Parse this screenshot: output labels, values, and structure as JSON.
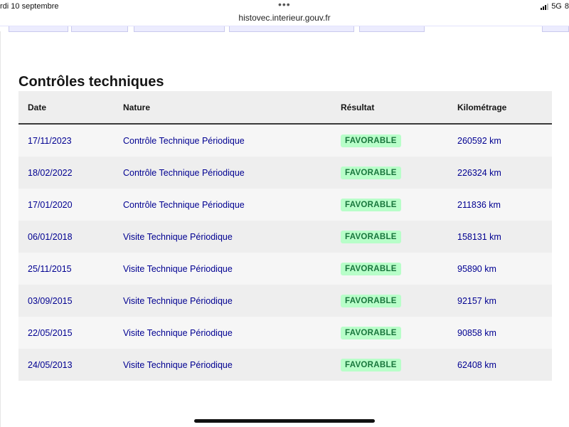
{
  "status_bar": {
    "date": "rdi 10 septembre",
    "network": "5G",
    "battery_partial": "8"
  },
  "browser": {
    "url": "histovec.interieur.gouv.fr"
  },
  "section": {
    "title": "Contrôles techniques"
  },
  "table": {
    "headers": {
      "date": "Date",
      "nature": "Nature",
      "resultat": "Résultat",
      "kilometrage": "Kilométrage"
    },
    "rows": [
      {
        "date": "17/11/2023",
        "nature": "Contrôle Technique Périodique",
        "resultat": "FAVORABLE",
        "km": "260592 km"
      },
      {
        "date": "18/02/2022",
        "nature": "Contrôle Technique Périodique",
        "resultat": "FAVORABLE",
        "km": "226324 km"
      },
      {
        "date": "17/01/2020",
        "nature": "Contrôle Technique Périodique",
        "resultat": "FAVORABLE",
        "km": "211836 km"
      },
      {
        "date": "06/01/2018",
        "nature": "Visite Technique Périodique",
        "resultat": "FAVORABLE",
        "km": "158131 km"
      },
      {
        "date": "25/11/2015",
        "nature": "Visite Technique Périodique",
        "resultat": "FAVORABLE",
        "km": "95890 km"
      },
      {
        "date": "03/09/2015",
        "nature": "Visite Technique Périodique",
        "resultat": "FAVORABLE",
        "km": "92157 km"
      },
      {
        "date": "22/05/2015",
        "nature": "Visite Technique Périodique",
        "resultat": "FAVORABLE",
        "km": "90858 km"
      },
      {
        "date": "24/05/2013",
        "nature": "Visite Technique Périodique",
        "resultat": "FAVORABLE",
        "km": "62408 km"
      }
    ]
  },
  "colors": {
    "link": "#000091",
    "badge_bg": "#b8fec9",
    "badge_text": "#18753c"
  }
}
